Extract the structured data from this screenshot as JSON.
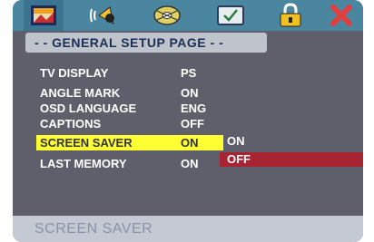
{
  "topbar": {
    "tabs": [
      {
        "name": "general-tab",
        "icon": "picture-icon"
      },
      {
        "name": "audio-tab",
        "icon": "speaker-icon"
      },
      {
        "name": "dolby-tab",
        "icon": "disc-icon"
      },
      {
        "name": "video-tab",
        "icon": "monitor-check-icon"
      },
      {
        "name": "password-tab",
        "icon": "padlock-icon"
      },
      {
        "name": "exit-tab",
        "icon": "close-icon"
      }
    ]
  },
  "page": {
    "title": "- - GENERAL SETUP PAGE - -"
  },
  "menu": {
    "items": [
      {
        "label": "TV DISPLAY",
        "value": "PS"
      },
      {
        "label": "ANGLE MARK",
        "value": "ON"
      },
      {
        "label": "OSD LANGUAGE",
        "value": "ENG"
      },
      {
        "label": "CAPTIONS",
        "value": "OFF"
      },
      {
        "label": "SCREEN SAVER",
        "value": "ON"
      },
      {
        "label": "LAST MEMORY",
        "value": "ON"
      }
    ],
    "selected_index": 4
  },
  "options": {
    "on": "ON",
    "off": "OFF",
    "highlighted": "OFF"
  },
  "status": {
    "text": "SCREEN SAVER"
  },
  "colors": {
    "background": "#5f5f6b",
    "topbar": "#4b86a0",
    "selection": "#ffff33",
    "option_highlight": "#a82432",
    "status_bar": "#c4c9d3"
  }
}
